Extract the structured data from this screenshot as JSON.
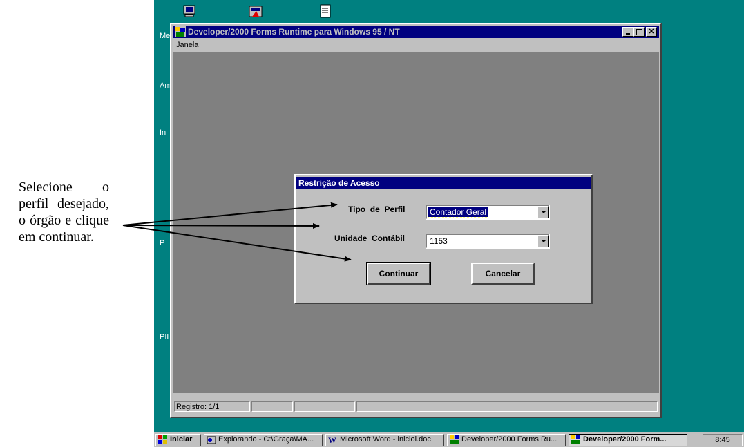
{
  "desktop": {
    "background": "#008080",
    "icon_labels": [
      "Me",
      "Am",
      "In",
      "P",
      "PIL"
    ]
  },
  "window": {
    "title": "Developer/2000 Forms Runtime para Windows 95 / NT",
    "menu": [
      "Janela"
    ],
    "controls": [
      "minimize",
      "maximize",
      "close"
    ],
    "status": "Registro: 1/1"
  },
  "dialog": {
    "title": "Restrição de  Acesso",
    "fields": [
      {
        "label": "Tipo_de_Perfil",
        "value": "Contador Geral"
      },
      {
        "label": "Unidade_Contábil",
        "value": "1153"
      }
    ],
    "buttons": {
      "continue": "Continuar",
      "cancel": "Cancelar"
    }
  },
  "taskbar": {
    "start": "Iniciar",
    "tasks": [
      {
        "label": "Explorando - C:\\Graça\\MA...",
        "icon": "explorer-icon"
      },
      {
        "label": "Microsoft Word - iniciol.doc",
        "icon": "word-icon"
      },
      {
        "label": "Developer/2000 Forms Ru...",
        "icon": "forms-icon"
      },
      {
        "label": "Developer/2000 Form...",
        "icon": "forms-icon",
        "active": true
      }
    ],
    "clock": "8:45"
  },
  "callout": {
    "text": "Selecione o perfil desejado, o órgão e clique em continuar."
  }
}
